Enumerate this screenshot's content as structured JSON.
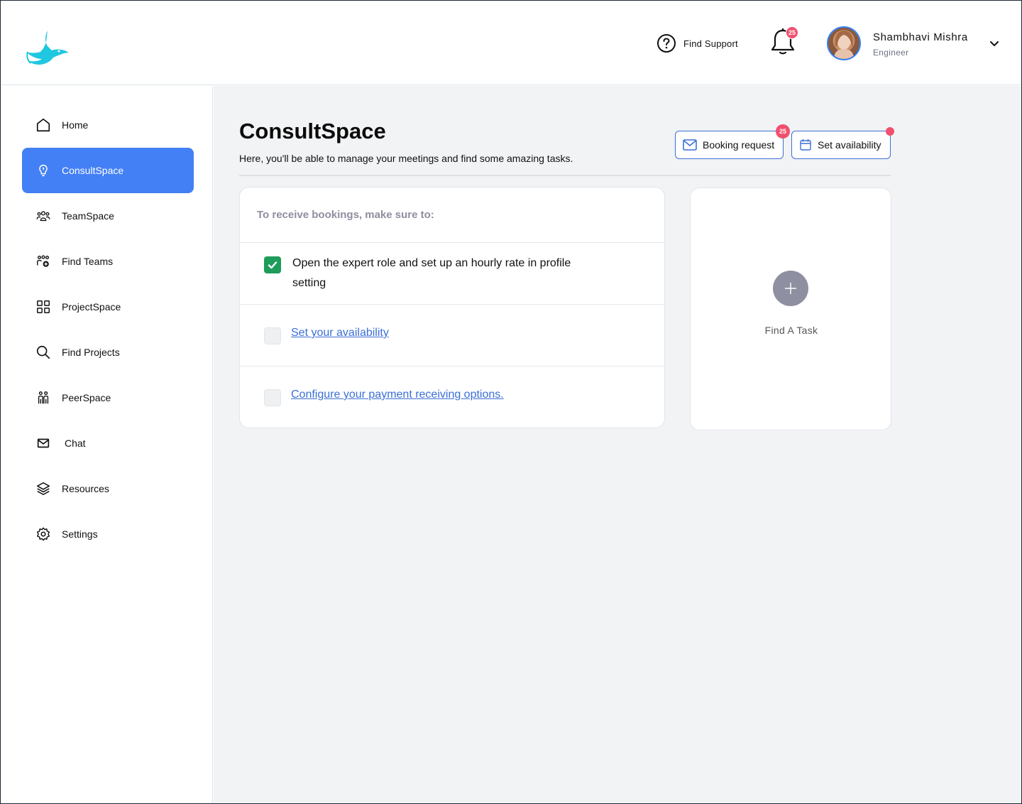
{
  "header": {
    "support_label": "Find Support",
    "notification_count": "25",
    "user": {
      "name": "Shambhavi Mishra",
      "role": "Engineer"
    }
  },
  "sidebar": {
    "items": [
      {
        "label": "Home",
        "icon": "home-icon",
        "active": false
      },
      {
        "label": "ConsultSpace",
        "icon": "lightbulb-icon",
        "active": true
      },
      {
        "label": "TeamSpace",
        "icon": "team-icon",
        "active": false
      },
      {
        "label": "Find Teams",
        "icon": "find-teams-icon",
        "active": false
      },
      {
        "label": "ProjectSpace",
        "icon": "grid-icon",
        "active": false
      },
      {
        "label": "Find Projects",
        "icon": "search-icon",
        "active": false
      },
      {
        "label": "PeerSpace",
        "icon": "peers-icon",
        "active": false
      },
      {
        "label": "Chat",
        "icon": "mail-icon",
        "active": false
      },
      {
        "label": "Resources",
        "icon": "layers-icon",
        "active": false
      },
      {
        "label": "Settings",
        "icon": "gear-icon",
        "active": false
      }
    ]
  },
  "main": {
    "title": "ConsultSpace",
    "subtitle": "Here, you'll be able to manage your meetings and find some amazing tasks.",
    "booking_button": {
      "label": "Booking request",
      "count": "25"
    },
    "availability_button": {
      "label": "Set availability"
    },
    "checklist": {
      "heading": "To receive bookings, make sure to:",
      "items": [
        {
          "text": "Open the expert role and set up an hourly rate in profile setting",
          "checked": true
        },
        {
          "text": "Set your availability",
          "checked": false,
          "link": true
        },
        {
          "text": "Configure your payment receiving options.",
          "checked": false,
          "link": true
        }
      ]
    },
    "task_card": {
      "label": "Find A Task"
    }
  },
  "colors": {
    "accent": "#4380f5",
    "link": "#3b6fd6",
    "badge": "#f0506e",
    "check": "#1e9c5a",
    "logo": "#1fc7e0"
  }
}
